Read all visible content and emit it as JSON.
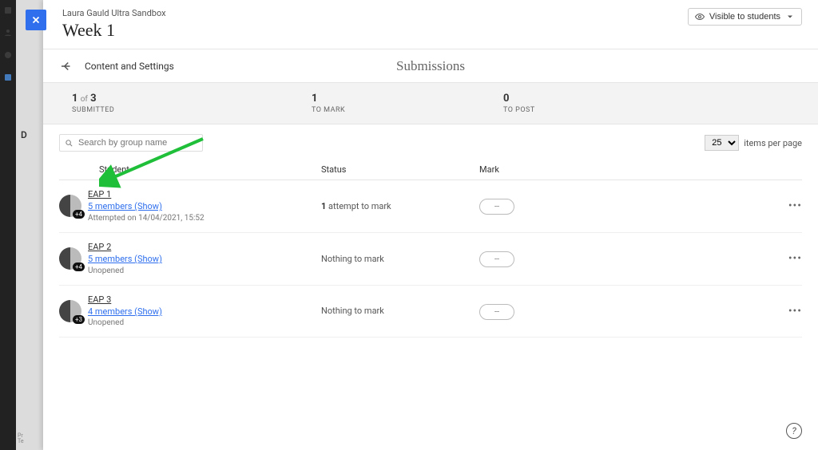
{
  "header": {
    "sandbox": "Laura Gauld Ultra Sandbox",
    "title": "Week 1",
    "visibility_label": "Visible to students"
  },
  "subheader": {
    "content_link": "Content and Settings",
    "title": "Submissions"
  },
  "stats": {
    "submitted_count": "1",
    "submitted_total": "3",
    "submitted_of": "of",
    "submitted_label": "SUBMITTED",
    "to_mark_count": "1",
    "to_mark_label": "TO MARK",
    "to_post_count": "0",
    "to_post_label": "TO POST"
  },
  "search": {
    "placeholder": "Search by group name"
  },
  "pager": {
    "per_page": "25",
    "label": "items per page"
  },
  "columns": {
    "student": "Student",
    "status": "Status",
    "mark": "Mark"
  },
  "rows": [
    {
      "group": "EAP 1",
      "members": "5 members (Show)",
      "meta": "Attempted on 14/04/2021, 15:52",
      "status_bold": "1",
      "status_rest": " attempt to mark",
      "mark": "--",
      "badge": "+4"
    },
    {
      "group": "EAP 2",
      "members": "5 members (Show)",
      "meta": "Unopened",
      "status_bold": "",
      "status_rest": "Nothing to mark",
      "mark": "--",
      "badge": "+4"
    },
    {
      "group": "EAP 3",
      "members": "4 members (Show)",
      "meta": "Unopened",
      "status_bold": "",
      "status_rest": "Nothing to mark",
      "mark": "--",
      "badge": "+3"
    }
  ],
  "behind_label": "D",
  "help": "?"
}
